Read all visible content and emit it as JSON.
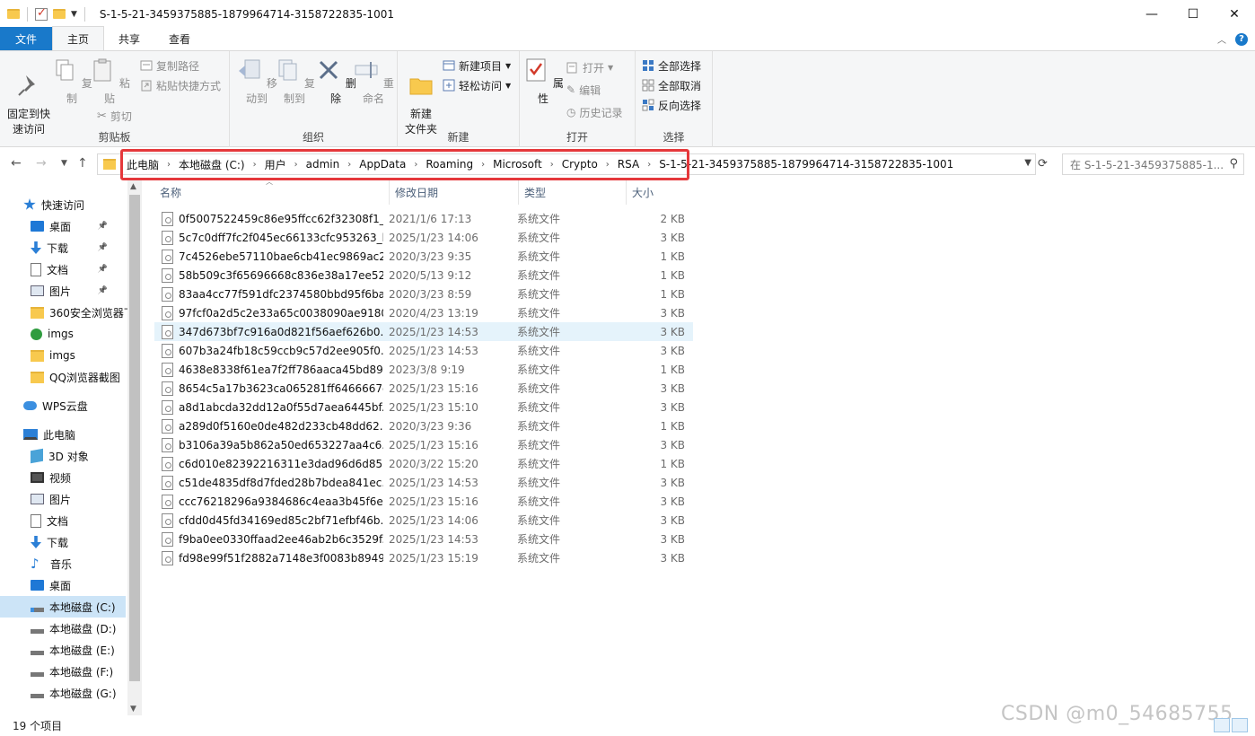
{
  "window": {
    "title": "S-1-5-21-3459375885-1879964714-3158722835-1001",
    "minimize": "—",
    "maximize": "☐",
    "close": "✕"
  },
  "tabs": [
    "文件",
    "主页",
    "共享",
    "查看"
  ],
  "ribbon": {
    "clipboard": {
      "label": "剪贴板",
      "pin": "固定到快\n速访问",
      "copy": "复制",
      "paste": "粘贴",
      "copy_path": "复制路径",
      "paste_shortcut": "粘贴快捷方式",
      "cut": "剪切"
    },
    "organize": {
      "label": "组织",
      "move_to": "移动到",
      "copy_to": "复制到",
      "delete": "删除",
      "rename": "重命名"
    },
    "new": {
      "label": "新建",
      "new_folder": "新建\n文件夹",
      "new_item": "新建项目",
      "easy_access": "轻松访问"
    },
    "open": {
      "label": "打开",
      "properties": "属性",
      "open": "打开",
      "edit": "编辑",
      "history": "历史记录"
    },
    "select": {
      "label": "选择",
      "select_all": "全部选择",
      "select_none": "全部取消",
      "invert": "反向选择"
    }
  },
  "address": {
    "crumbs": [
      "此电脑",
      "本地磁盘 (C:)",
      "用户",
      "admin",
      "AppData",
      "Roaming",
      "Microsoft",
      "Crypto",
      "RSA",
      "S-1-5-21-3459375885-1879964714-3158722835-1001"
    ],
    "search_placeholder": "在 S-1-5-21-3459375885-1..."
  },
  "nav": {
    "quick_access": "快速访问",
    "items": [
      {
        "label": "桌面",
        "pinned": true
      },
      {
        "label": "下载",
        "pinned": true
      },
      {
        "label": "文档",
        "pinned": true
      },
      {
        "label": "图片",
        "pinned": true
      },
      {
        "label": "360安全浏览器下",
        "pinned": false
      },
      {
        "label": "imgs",
        "pinned": false
      },
      {
        "label": "imgs",
        "pinned": false
      },
      {
        "label": "QQ浏览器截图",
        "pinned": false
      }
    ],
    "wps": "WPS云盘",
    "this_pc": "此电脑",
    "pc_items": [
      "3D 对象",
      "视频",
      "图片",
      "文档",
      "下载",
      "音乐",
      "桌面",
      "本地磁盘 (C:)",
      "本地磁盘 (D:)",
      "本地磁盘 (E:)",
      "本地磁盘 (F:)",
      "本地磁盘 (G:)"
    ]
  },
  "columns": {
    "name": "名称",
    "date": "修改日期",
    "type": "类型",
    "size": "大小"
  },
  "files": [
    {
      "name": "0f5007522459c86e95ffcc62f32308f1_...",
      "date": "2021/1/6 17:13",
      "type": "系统文件",
      "size": "2 KB"
    },
    {
      "name": "5c7c0dff7fc2f045ec66133cfc953263_b...",
      "date": "2025/1/23 14:06",
      "type": "系统文件",
      "size": "3 KB"
    },
    {
      "name": "7c4526ebe57110bae6cb41ec9869ac2...",
      "date": "2020/3/23 9:35",
      "type": "系统文件",
      "size": "1 KB"
    },
    {
      "name": "58b509c3f65696668c836e38a17ee52...",
      "date": "2020/5/13 9:12",
      "type": "系统文件",
      "size": "1 KB"
    },
    {
      "name": "83aa4cc77f591dfc2374580bbd95f6ba...",
      "date": "2020/3/23 8:59",
      "type": "系统文件",
      "size": "1 KB"
    },
    {
      "name": "97fcf0a2d5c2e33a65c0038090ae9180...",
      "date": "2020/4/23 13:19",
      "type": "系统文件",
      "size": "3 KB"
    },
    {
      "name": "347d673bf7c916a0d821f56aef626b0...",
      "date": "2025/1/23 14:53",
      "type": "系统文件",
      "size": "3 KB"
    },
    {
      "name": "607b3a24fb18c59ccb9c57d2ee905f0...",
      "date": "2025/1/23 14:53",
      "type": "系统文件",
      "size": "3 KB"
    },
    {
      "name": "4638e8338f61ea7f2ff786aaca45bd89...",
      "date": "2023/3/8 9:19",
      "type": "系统文件",
      "size": "1 KB"
    },
    {
      "name": "8654c5a17b3623ca065281ff6466667e...",
      "date": "2025/1/23 15:16",
      "type": "系统文件",
      "size": "3 KB"
    },
    {
      "name": "a8d1abcda32dd12a0f55d7aea6445bf...",
      "date": "2025/1/23 15:10",
      "type": "系统文件",
      "size": "3 KB"
    },
    {
      "name": "a289d0f5160e0de482d233cb48dd62...",
      "date": "2020/3/23 9:36",
      "type": "系统文件",
      "size": "1 KB"
    },
    {
      "name": "b3106a39a5b862a50ed653227aa4c6...",
      "date": "2025/1/23 15:16",
      "type": "系统文件",
      "size": "3 KB"
    },
    {
      "name": "c6d010e82392216311e3dad96d6d85...",
      "date": "2020/3/22 15:20",
      "type": "系统文件",
      "size": "1 KB"
    },
    {
      "name": "c51de4835df8d7fded28b7bdea841ec...",
      "date": "2025/1/23 14:53",
      "type": "系统文件",
      "size": "3 KB"
    },
    {
      "name": "ccc76218296a9384686c4eaa3b45f6ec...",
      "date": "2025/1/23 15:16",
      "type": "系统文件",
      "size": "3 KB"
    },
    {
      "name": "cfdd0d45fd34169ed85c2bf71efbf46b...",
      "date": "2025/1/23 14:06",
      "type": "系统文件",
      "size": "3 KB"
    },
    {
      "name": "f9ba0ee0330ffaad2ee46ab2b6c3529f...",
      "date": "2025/1/23 14:53",
      "type": "系统文件",
      "size": "3 KB"
    },
    {
      "name": "fd98e99f51f2882a7148e3f0083b8949...",
      "date": "2025/1/23 15:19",
      "type": "系统文件",
      "size": "3 KB"
    }
  ],
  "status": {
    "count": "19 个项目"
  },
  "watermark": "CSDN @m0_54685755",
  "colors": {
    "accent": "#1979ca",
    "highlight": "#e5383b",
    "folder": "#f8c94e"
  }
}
